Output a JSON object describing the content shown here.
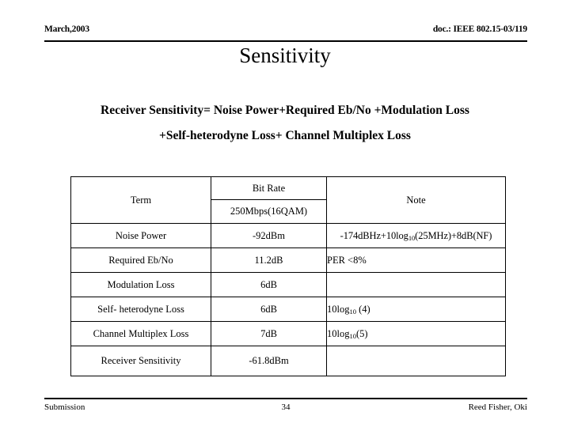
{
  "header": {
    "date": "March,2003",
    "doc_id": "doc.: IEEE 802.15-03/119"
  },
  "title": "Sensitivity",
  "formula": {
    "line1": "Receiver Sensitivity= Noise Power+Required Eb/No +Modulation Loss",
    "line2": "+Self-heterodyne Loss+ Channel Multiplex Loss"
  },
  "table": {
    "headers": {
      "term": "Term",
      "bit_rate": "Bit Rate",
      "bit_rate_value": "250Mbps(16QAM)",
      "note": "Note"
    },
    "rows": [
      {
        "term": "Noise Power",
        "value": "-92dBm",
        "note_prefix": "-174dBHz+10log",
        "note_sub": "10",
        "note_suffix": "(25MHz)+8dB(NF)",
        "note_plain": ""
      },
      {
        "term": "Required Eb/No",
        "value": "11.2dB",
        "note_plain": "PER <8%"
      },
      {
        "term": "Modulation Loss",
        "value": "6dB",
        "note_plain": ""
      },
      {
        "term": "Self- heterodyne Loss",
        "value": "6dB",
        "note_prefix": "10log",
        "note_sub": "10",
        "note_suffix": " (4)",
        "note_plain": ""
      },
      {
        "term": "Channel Multiplex Loss",
        "value": "7dB",
        "note_prefix": "10log",
        "note_sub": "10",
        "note_suffix": "(5)",
        "note_plain": ""
      },
      {
        "term": "Receiver Sensitivity",
        "value": "-61.8dBm",
        "note_plain": ""
      }
    ]
  },
  "footer": {
    "left": "Submission",
    "page": "34",
    "right": "Reed Fisher, Oki"
  }
}
